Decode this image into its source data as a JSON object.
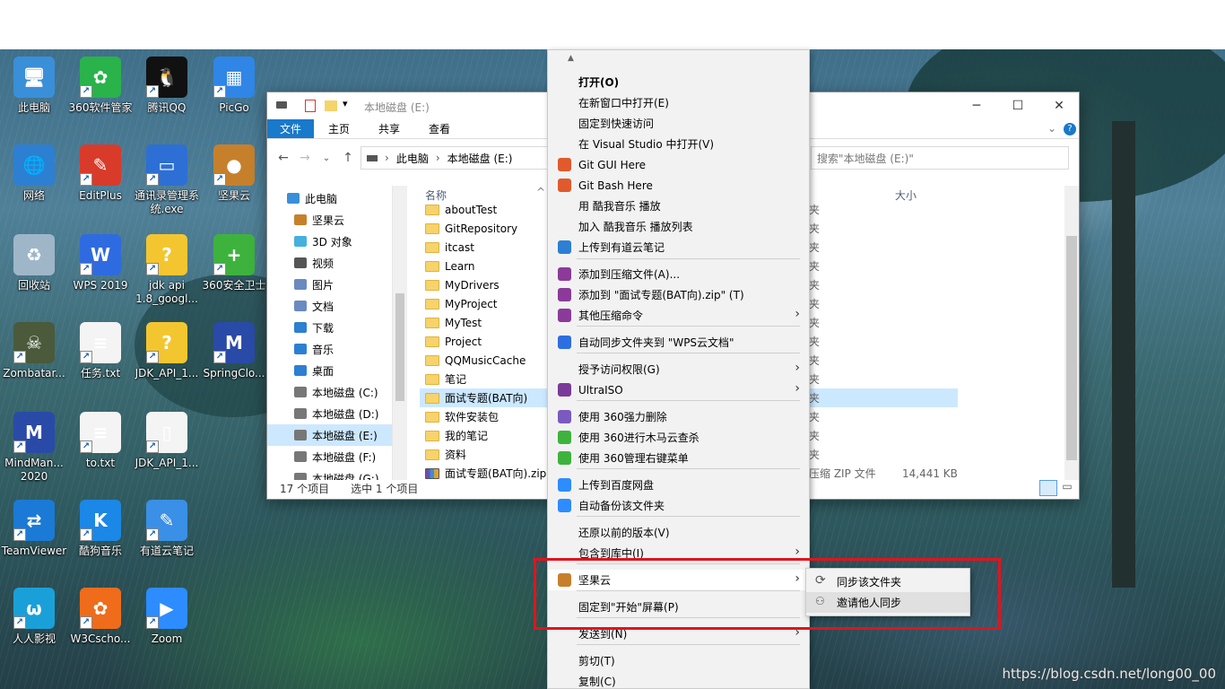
{
  "desktop": {
    "icons": [
      {
        "label": "此电脑",
        "color": "#3a8fd9",
        "glyph": "🖥"
      },
      {
        "label": "360软件管家",
        "color": "#29b34a",
        "glyph": "✿"
      },
      {
        "label": "腾讯QQ",
        "color": "#111111",
        "glyph": "🐧"
      },
      {
        "label": "PicGo",
        "color": "#2f86e6",
        "glyph": "▦"
      },
      {
        "label": "网络",
        "color": "#2d7fd2",
        "glyph": "🌐"
      },
      {
        "label": "EditPlus",
        "color": "#d93b2b",
        "glyph": "✎"
      },
      {
        "label": "通讯录管理系统.exe",
        "color": "#2d6fd4",
        "glyph": "▭"
      },
      {
        "label": "坚果云",
        "color": "#c6802c",
        "glyph": "●"
      },
      {
        "label": "回收站",
        "color": "#9fb6c9",
        "glyph": "♻"
      },
      {
        "label": "WPS 2019",
        "color": "#2f6be0",
        "glyph": "W"
      },
      {
        "label": "jdk api 1.8_googl...",
        "color": "#f3c630",
        "glyph": "?"
      },
      {
        "label": "360安全卫士",
        "color": "#3db33d",
        "glyph": "+"
      },
      {
        "label": "Zombatar...",
        "color": "#4a5a3a",
        "glyph": "☠"
      },
      {
        "label": "任务.txt",
        "color": "#f4f4f4",
        "glyph": "≡"
      },
      {
        "label": "JDK_API_1...",
        "color": "#f3c630",
        "glyph": "?"
      },
      {
        "label": "SpringClo...",
        "color": "#2a4aa8",
        "glyph": "M"
      },
      {
        "label": "MindMan... 2020",
        "color": "#2a4aa8",
        "glyph": "M"
      },
      {
        "label": "to.txt",
        "color": "#f4f4f4",
        "glyph": "≡"
      },
      {
        "label": "JDK_API_1...",
        "color": "#f4f4f4",
        "glyph": "▯"
      },
      {
        "label": "TeamViewer",
        "color": "#1a7ad6",
        "glyph": "⇄"
      },
      {
        "label": "酷狗音乐",
        "color": "#1b87e6",
        "glyph": "K"
      },
      {
        "label": "有道云笔记",
        "color": "#3a8fe6",
        "glyph": "✎"
      },
      {
        "label": "人人影视",
        "color": "#1aa0d8",
        "glyph": "ω"
      },
      {
        "label": "W3Cscho...",
        "color": "#ef6c1a",
        "glyph": "✿"
      },
      {
        "label": "Zoom",
        "color": "#2d8cff",
        "glyph": "▶"
      }
    ]
  },
  "explorer": {
    "title": "本地磁盘 (E:)",
    "ribbon_tabs": [
      "文件",
      "主页",
      "共享",
      "查看"
    ],
    "breadcrumb": [
      "此电脑",
      "本地磁盘 (E:)"
    ],
    "search_placeholder": "搜索\"本地磁盘 (E:)\"",
    "nav_items": [
      {
        "label": "此电脑",
        "color": "#3a8fd9"
      },
      {
        "label": "坚果云",
        "color": "#c6802c"
      },
      {
        "label": "3D 对象",
        "color": "#45b0e0"
      },
      {
        "label": "视频",
        "color": "#555555"
      },
      {
        "label": "图片",
        "color": "#6a8ac0"
      },
      {
        "label": "文档",
        "color": "#6a8ac0"
      },
      {
        "label": "下载",
        "color": "#2d7fd2"
      },
      {
        "label": "音乐",
        "color": "#2d7fd2"
      },
      {
        "label": "桌面",
        "color": "#2d7fd2"
      },
      {
        "label": "本地磁盘 (C:)",
        "color": "#777777"
      },
      {
        "label": "本地磁盘 (D:)",
        "color": "#777777"
      },
      {
        "label": "本地磁盘 (E:)",
        "color": "#777777"
      },
      {
        "label": "本地磁盘 (F:)",
        "color": "#777777"
      },
      {
        "label": "本地磁盘 (G:)",
        "color": "#777777"
      }
    ],
    "columns": {
      "name": "名称",
      "size": "大小"
    },
    "files": [
      {
        "name": "aboutTest",
        "type": "夹",
        "size": ""
      },
      {
        "name": "GitRepository",
        "type": "夹",
        "size": ""
      },
      {
        "name": "itcast",
        "type": "夹",
        "size": ""
      },
      {
        "name": "Learn",
        "type": "夹",
        "size": ""
      },
      {
        "name": "MyDrivers",
        "type": "夹",
        "size": ""
      },
      {
        "name": "MyProject",
        "type": "夹",
        "size": ""
      },
      {
        "name": "MyTest",
        "type": "夹",
        "size": ""
      },
      {
        "name": "Project",
        "type": "夹",
        "size": ""
      },
      {
        "name": "QQMusicCache",
        "type": "夹",
        "size": ""
      },
      {
        "name": "笔记",
        "type": "夹",
        "size": ""
      },
      {
        "name": "面试专题(BAT向)",
        "type": "夹",
        "size": ""
      },
      {
        "name": "软件安装包",
        "type": "夹",
        "size": ""
      },
      {
        "name": "我的笔记",
        "type": "夹",
        "size": ""
      },
      {
        "name": "资料",
        "type": "夹",
        "size": ""
      },
      {
        "name": "面试专题(BAT向).zip",
        "type": "压缩 ZIP 文件",
        "size": "14,441 KB"
      }
    ],
    "selected_file": "面试专题(BAT向)",
    "status_count": "17 个项目",
    "status_selected": "选中 1 个项目"
  },
  "context_menu": {
    "items": [
      {
        "label": "打开(O)",
        "bold": true,
        "icon": ""
      },
      {
        "label": "在新窗口中打开(E)",
        "icon": ""
      },
      {
        "label": "固定到快速访问",
        "icon": ""
      },
      {
        "label": "在 Visual Studio 中打开(V)",
        "icon": ""
      },
      {
        "label": "Git GUI Here",
        "icon": "#e05a2c"
      },
      {
        "label": "Git Bash Here",
        "icon": "#e05a2c"
      },
      {
        "label": "用 酷我音乐 播放",
        "icon": ""
      },
      {
        "label": "加入 酷我音乐 播放列表",
        "icon": ""
      },
      {
        "label": "上传到有道云笔记",
        "icon": "#2d7fd2"
      },
      {
        "label": "添加到压缩文件(A)...",
        "icon": "#8b3a9a"
      },
      {
        "label": "添加到 \"面试专题(BAT向).zip\" (T)",
        "icon": "#8b3a9a"
      },
      {
        "label": "其他压缩命令",
        "icon": "#8b3a9a",
        "arrow": true
      },
      {
        "label": "自动同步文件夹到 \"WPS云文档\"",
        "icon": "#2d6fe0"
      },
      {
        "label": "授予访问权限(G)",
        "icon": "",
        "arrow": true
      },
      {
        "label": "UltraISO",
        "icon": "#7a3a9a",
        "arrow": true
      },
      {
        "label": "使用 360强力删除",
        "icon": "#7a5ac0"
      },
      {
        "label": "使用 360进行木马云查杀",
        "icon": "#3db33d"
      },
      {
        "label": "使用 360管理右键菜单",
        "icon": "#3db33d"
      },
      {
        "label": "上传到百度网盘",
        "icon": "#2d8cff"
      },
      {
        "label": "自动备份该文件夹",
        "icon": "#2d8cff"
      },
      {
        "label": "还原以前的版本(V)",
        "icon": ""
      },
      {
        "label": "包含到库中(I)",
        "icon": "",
        "arrow": true
      },
      {
        "label": "坚果云",
        "icon": "#c6802c",
        "arrow": true
      },
      {
        "label": "固定到\"开始\"屏幕(P)",
        "icon": ""
      },
      {
        "label": "发送到(N)",
        "icon": "",
        "arrow": true
      },
      {
        "label": "剪切(T)",
        "icon": ""
      },
      {
        "label": "复制(C)",
        "icon": ""
      }
    ],
    "submenu": [
      {
        "label": "同步该文件夹",
        "icon": "sync-icon"
      },
      {
        "label": "邀请他人同步",
        "icon": "invite-users-icon"
      }
    ]
  },
  "watermark": "https://blog.csdn.net/long00_00"
}
